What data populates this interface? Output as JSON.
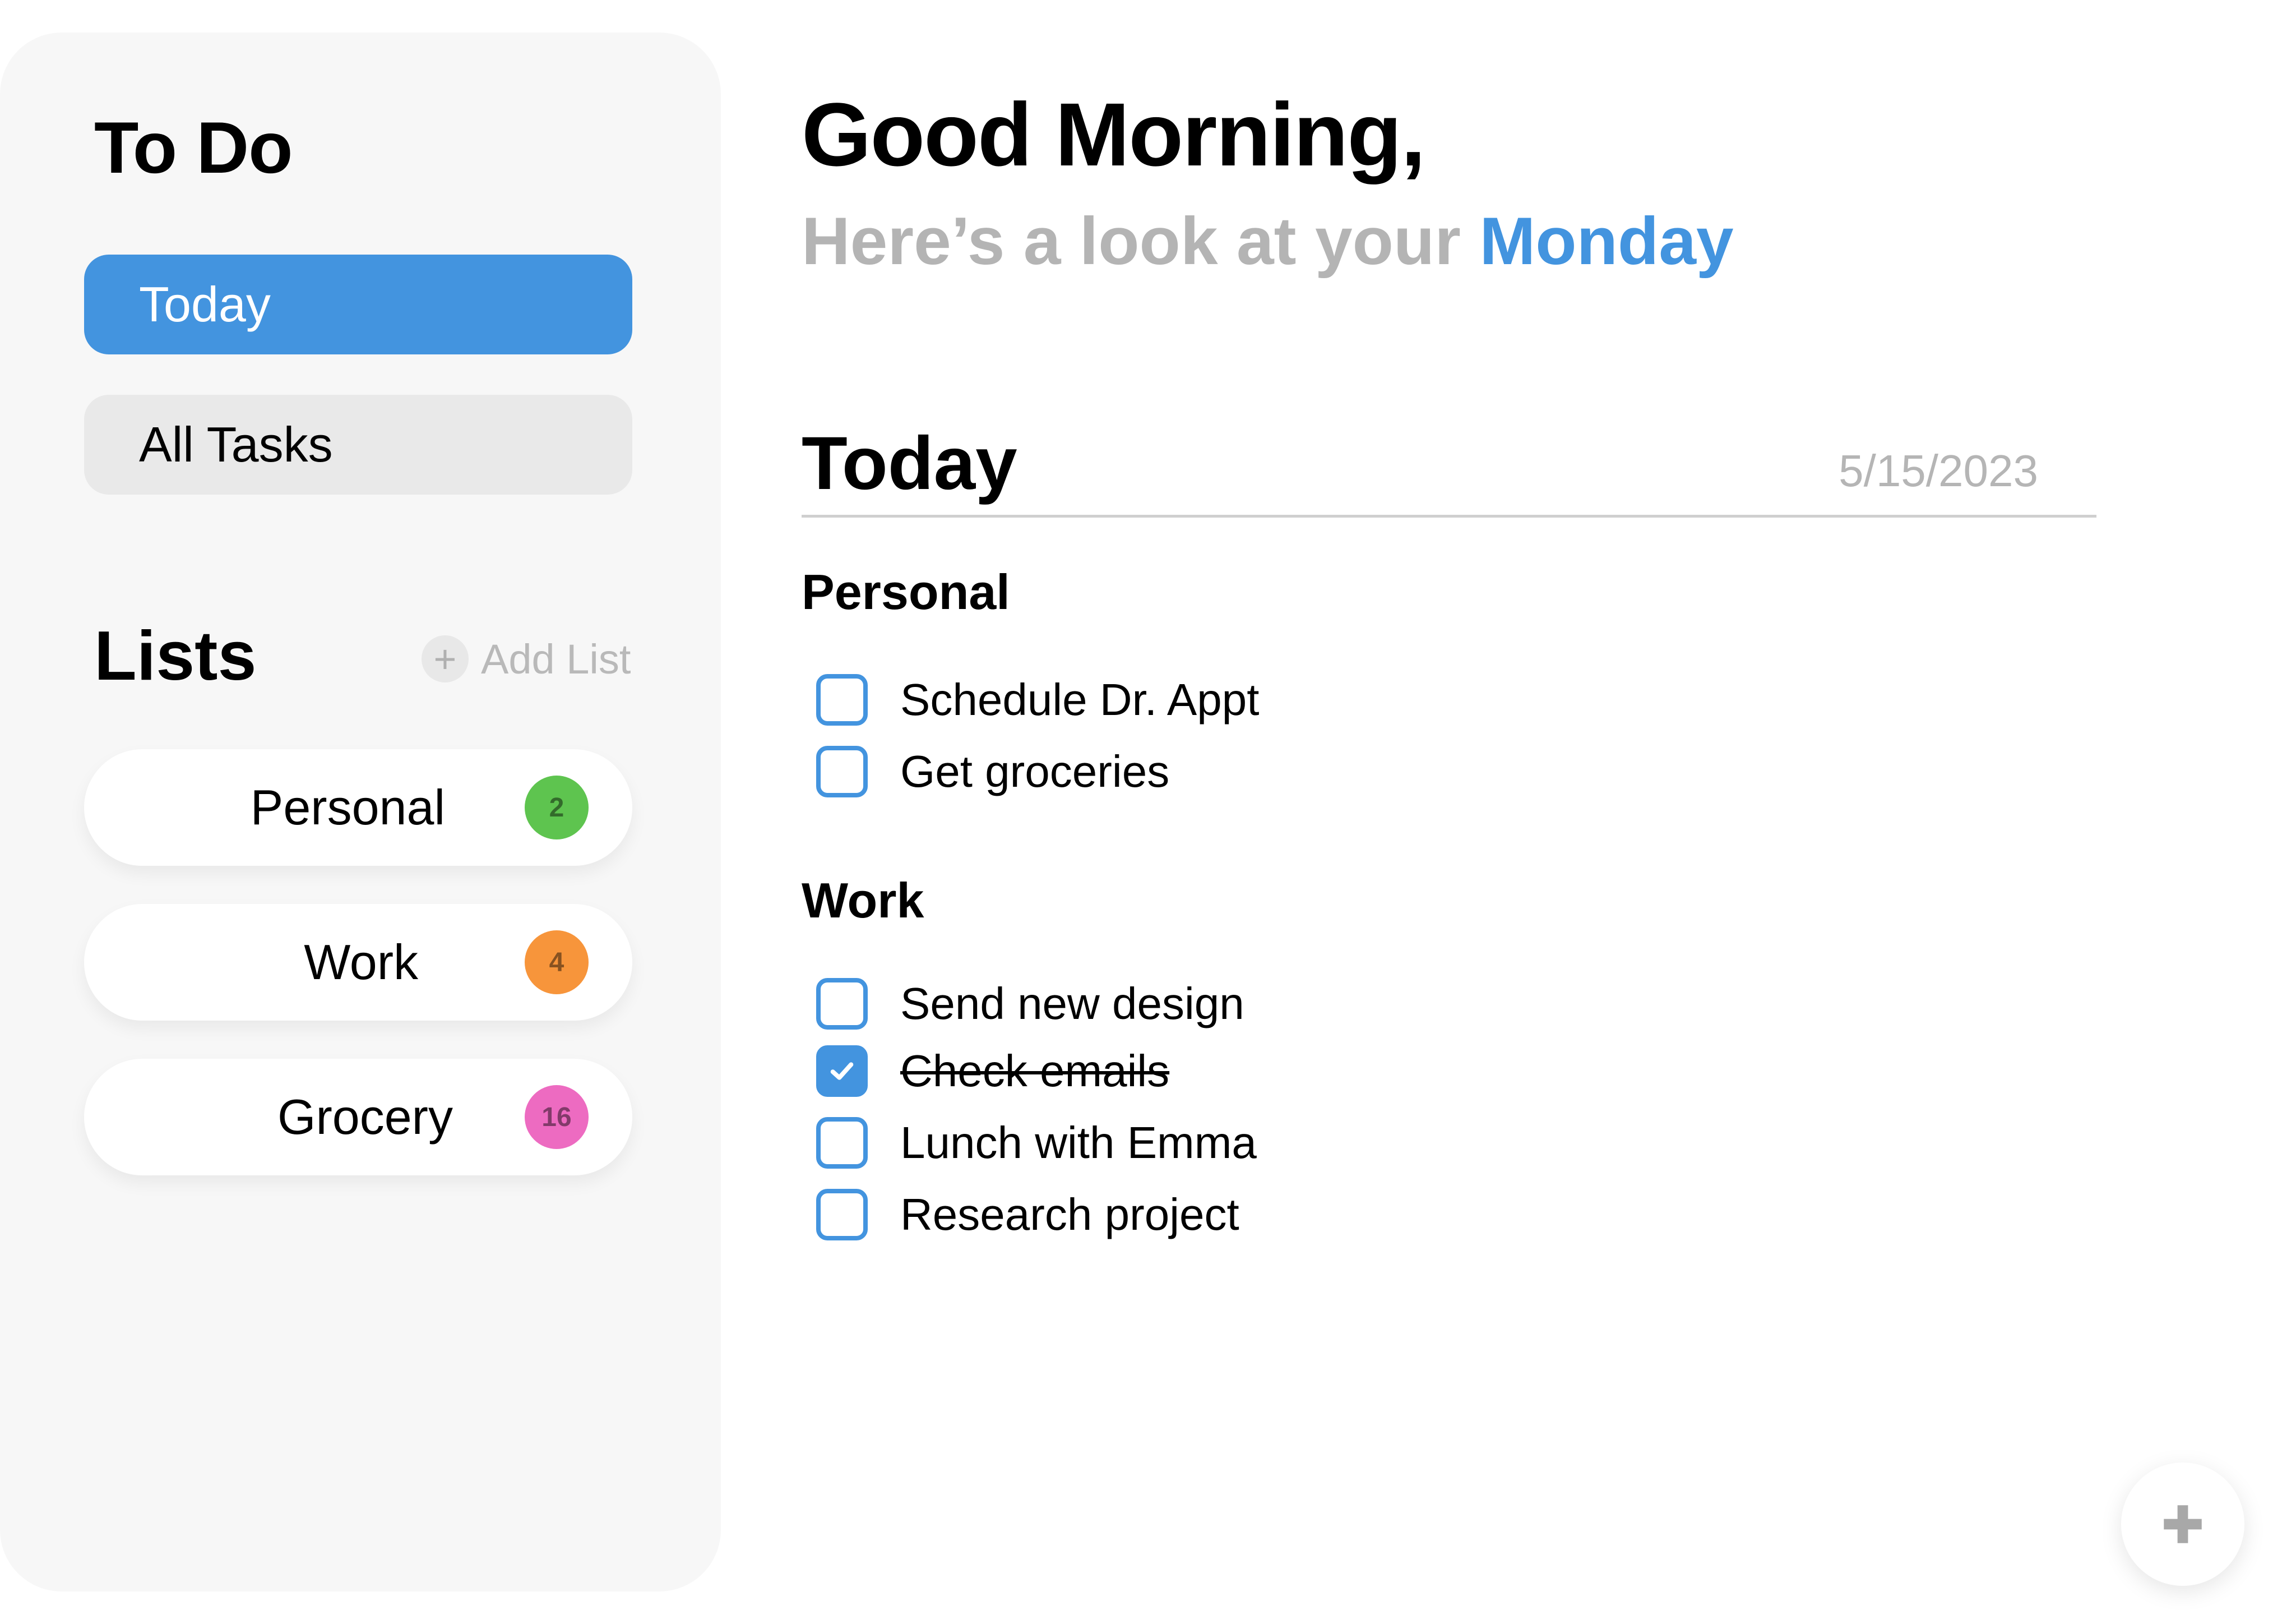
{
  "sidebar": {
    "app_title": "To Do",
    "nav": [
      {
        "label": "Today",
        "active": true
      },
      {
        "label": "All Tasks",
        "active": false
      }
    ],
    "lists_title": "Lists",
    "add_list_label": "Add List",
    "add_list_icon": "plus-icon",
    "lists": [
      {
        "label": "Personal",
        "count": "2",
        "color": "#5ec44f"
      },
      {
        "label": "Work",
        "count": "4",
        "color": "#f7953b"
      },
      {
        "label": "Grocery",
        "count": "16",
        "color": "#ed6bc1"
      }
    ]
  },
  "main": {
    "greeting": "Good Morning,",
    "subline_prefix": "Here’s a look at your ",
    "subline_day": "Monday",
    "section_title": "Today",
    "date": "5/15/2023",
    "groups": [
      {
        "title": "Personal",
        "tasks": [
          {
            "label": "Schedule Dr. Appt",
            "done": false
          },
          {
            "label": "Get groceries",
            "done": false
          }
        ]
      },
      {
        "title": "Work",
        "tasks": [
          {
            "label": "Send new design",
            "done": false
          },
          {
            "label": "Check emails",
            "done": true
          },
          {
            "label": "Lunch with Emma",
            "done": false
          },
          {
            "label": "Research project",
            "done": false
          }
        ]
      }
    ],
    "fab_icon": "plus-icon"
  },
  "colors": {
    "accent": "#4394df",
    "sidebar_bg": "#f7f7f7",
    "muted_text": "#b4b4b4"
  }
}
